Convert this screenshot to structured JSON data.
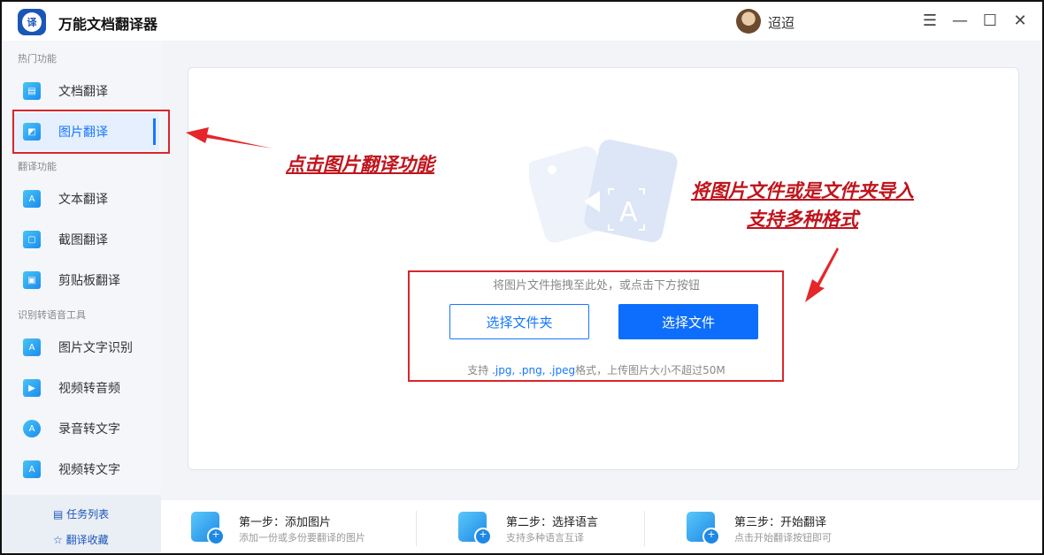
{
  "app": {
    "title": "万能文档翻译器",
    "logo_text": "译"
  },
  "user": {
    "name": "迢迢"
  },
  "window_controls": {
    "menu": "☰",
    "minimize": "—",
    "maximize": "☐",
    "close": "✕"
  },
  "sidebar": {
    "sections": [
      {
        "label": "热门功能"
      },
      {
        "label": "翻译功能"
      },
      {
        "label": "识别转语音工具"
      }
    ],
    "items": [
      {
        "label": "文档翻译",
        "icon": "document-icon"
      },
      {
        "label": "图片翻译",
        "icon": "image-icon",
        "active": true
      },
      {
        "label": "文本翻译",
        "icon": "text-icon"
      },
      {
        "label": "截图翻译",
        "icon": "screenshot-icon"
      },
      {
        "label": "剪贴板翻译",
        "icon": "clipboard-icon"
      },
      {
        "label": "图片文字识别",
        "icon": "ocr-icon"
      },
      {
        "label": "视频转音频",
        "icon": "video-audio-icon"
      },
      {
        "label": "录音转文字",
        "icon": "recording-icon"
      },
      {
        "label": "视频转文字",
        "icon": "video-text-icon"
      }
    ],
    "bottom": {
      "tasks": "任务列表",
      "favorites": "翻译收藏"
    }
  },
  "main": {
    "drop_hint": "将图片文件拖拽至此处，或点击下方按钮",
    "select_folder": "选择文件夹",
    "select_file": "选择文件",
    "support_prefix": "支持 ",
    "support_formats": ".jpg, .png, .jpeg",
    "support_suffix": "格式，上传图片大小不超过50M"
  },
  "annotations": {
    "left": "点击图片翻译功能",
    "right_line1": "将图片文件或是文件夹导入",
    "right_line2": "支持多种格式"
  },
  "steps": [
    {
      "title": "第一步：添加图片",
      "subtitle": "添加一份或多份要翻译的图片"
    },
    {
      "title": "第二步：选择语言",
      "subtitle": "支持多种语言互译"
    },
    {
      "title": "第三步：开始翻译",
      "subtitle": "点击开始翻译按钮即可"
    }
  ],
  "colors": {
    "accent": "#1677ff",
    "annotation_red": "#d9262b"
  }
}
